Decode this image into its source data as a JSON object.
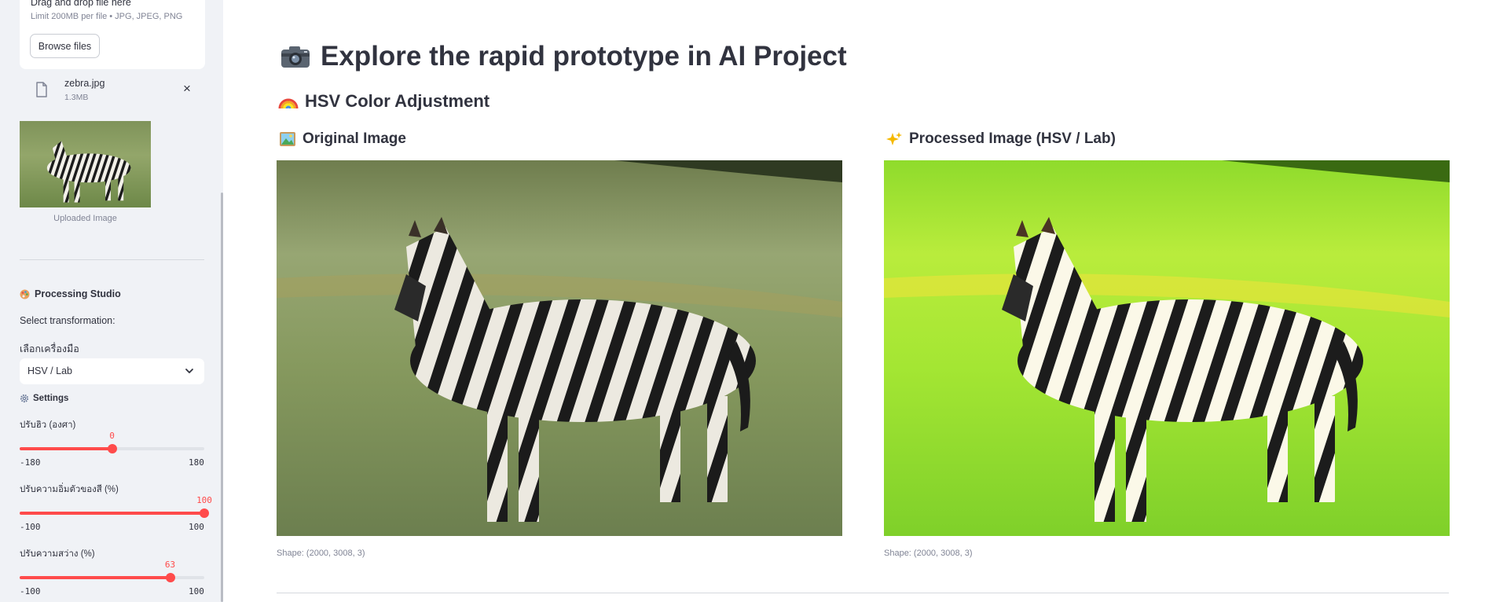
{
  "sidebar": {
    "uploader": {
      "drag_text": "Drag and drop file here",
      "limit_text": "Limit 200MB per file • JPG, JPEG, PNG",
      "browse_label": "Browse files"
    },
    "file": {
      "name": "zebra.jpg",
      "size": "1.3MB",
      "close_symbol": "×"
    },
    "thumbnail_caption": "Uploaded Image",
    "studio_title": "Processing Studio",
    "select_transformation_label": "Select transformation:",
    "tool_label": "เลือกเครื่องมือ",
    "tool_value": "HSV / Lab",
    "settings_title": "Settings",
    "sliders": [
      {
        "label": "ปรับฮิว (องศา)",
        "value": "0",
        "min": "-180",
        "max": "180",
        "fraction": 0.5
      },
      {
        "label": "ปรับความอิ่มตัวของสี (%)",
        "value": "100",
        "min": "-100",
        "max": "100",
        "fraction": 1.0
      },
      {
        "label": "ปรับความสว่าง (%)",
        "value": "63",
        "min": "-100",
        "max": "100",
        "fraction": 0.815
      }
    ]
  },
  "main": {
    "title": "Explore the rapid prototype in AI Project",
    "subtitle": "HSV Color Adjustment",
    "original": {
      "title": "Original Image",
      "shape": "Shape: (2000, 3008, 3)"
    },
    "processed": {
      "title": "Processed Image (HSV / Lab)",
      "shape": "Shape: (2000, 3008, 3)"
    }
  },
  "colors": {
    "accent": "#ff4b4b",
    "sidebar_bg": "#f0f2f6",
    "text": "#31333f",
    "muted": "#808495"
  },
  "icons": [
    "file-icon",
    "close-icon",
    "chevron-down-icon",
    "palette-icon",
    "gear-icon",
    "camera-icon",
    "rainbow-icon",
    "picture-icon",
    "sparkles-icon"
  ]
}
